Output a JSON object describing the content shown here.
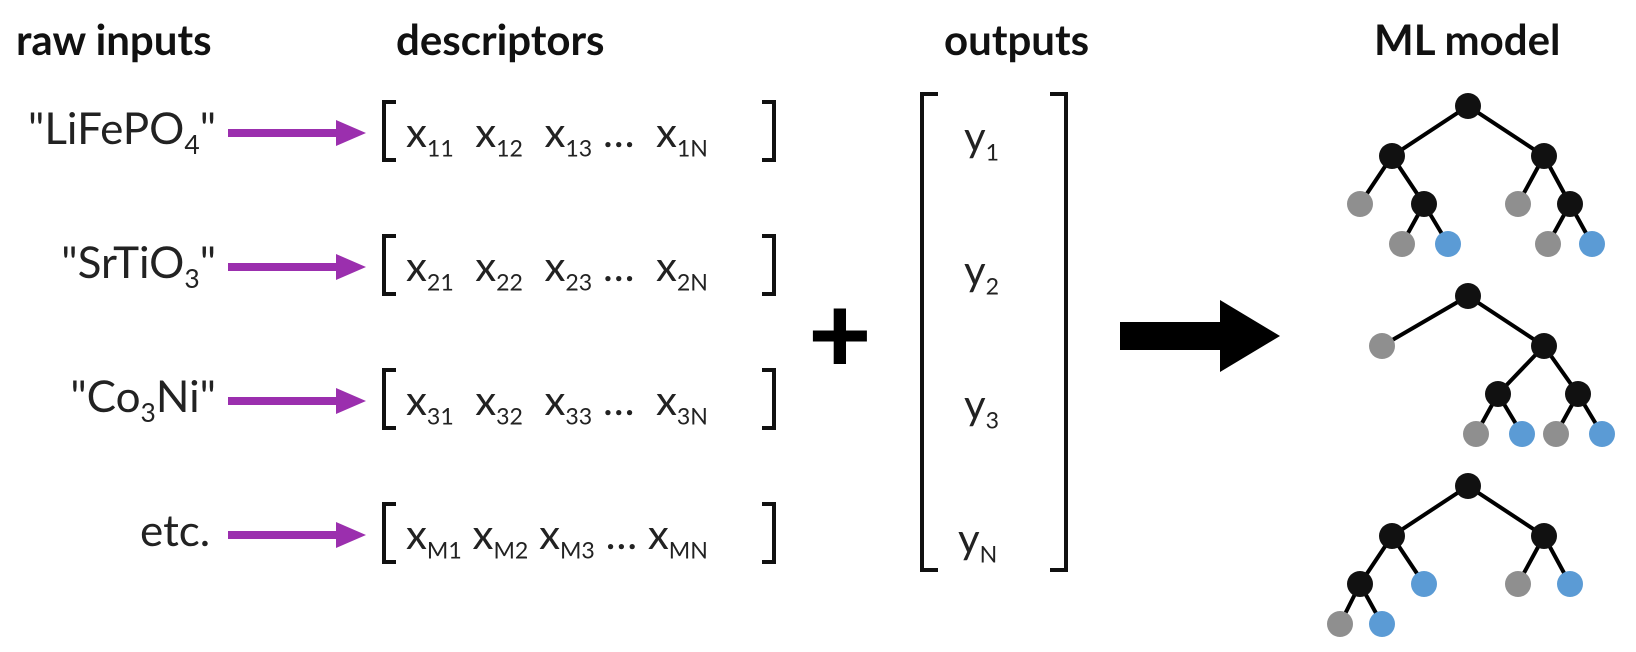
{
  "headings": {
    "raw_inputs": "raw inputs",
    "descriptors": "descriptors",
    "outputs": "outputs",
    "ml_model": "ML model"
  },
  "inputs": {
    "r1_pre": "\"LiFePO",
    "r1_sub": "4",
    "r1_post": "\"",
    "r2_pre": "\"SrTiO",
    "r2_sub": "3",
    "r2_post": "\"",
    "r3_pre": "\"Co",
    "r3_sub": "3",
    "r3_post": "Ni\"",
    "etc": "etc."
  },
  "descriptors": {
    "row1": {
      "a": "x",
      "as": "11",
      "b": "x",
      "bs": "12",
      "c": "x",
      "cs": "13",
      "dots": "…",
      "e": "x",
      "es": "1N"
    },
    "row2": {
      "a": "x",
      "as": "21",
      "b": "x",
      "bs": "22",
      "c": "x",
      "cs": "23",
      "dots": "…",
      "e": "x",
      "es": "2N"
    },
    "row3": {
      "a": "x",
      "as": "31",
      "b": "x",
      "bs": "32",
      "c": "x",
      "cs": "33",
      "dots": "…",
      "e": "x",
      "es": "3N"
    },
    "row4": {
      "a": "x",
      "as": "M1",
      "b": "x",
      "bs": "M2",
      "c": "x",
      "cs": "M3",
      "dots": "…",
      "e": "x",
      "es": "MN"
    }
  },
  "outputs": {
    "y1": "y",
    "y1s": "1",
    "y2": "y",
    "y2s": "2",
    "y3": "y",
    "y3s": "3",
    "yN": "y",
    "yNs": "N"
  },
  "colors": {
    "purple": "#9b2fae",
    "black": "#111111",
    "gray": "#8f8f8f",
    "blue": "#5b9bd5"
  }
}
